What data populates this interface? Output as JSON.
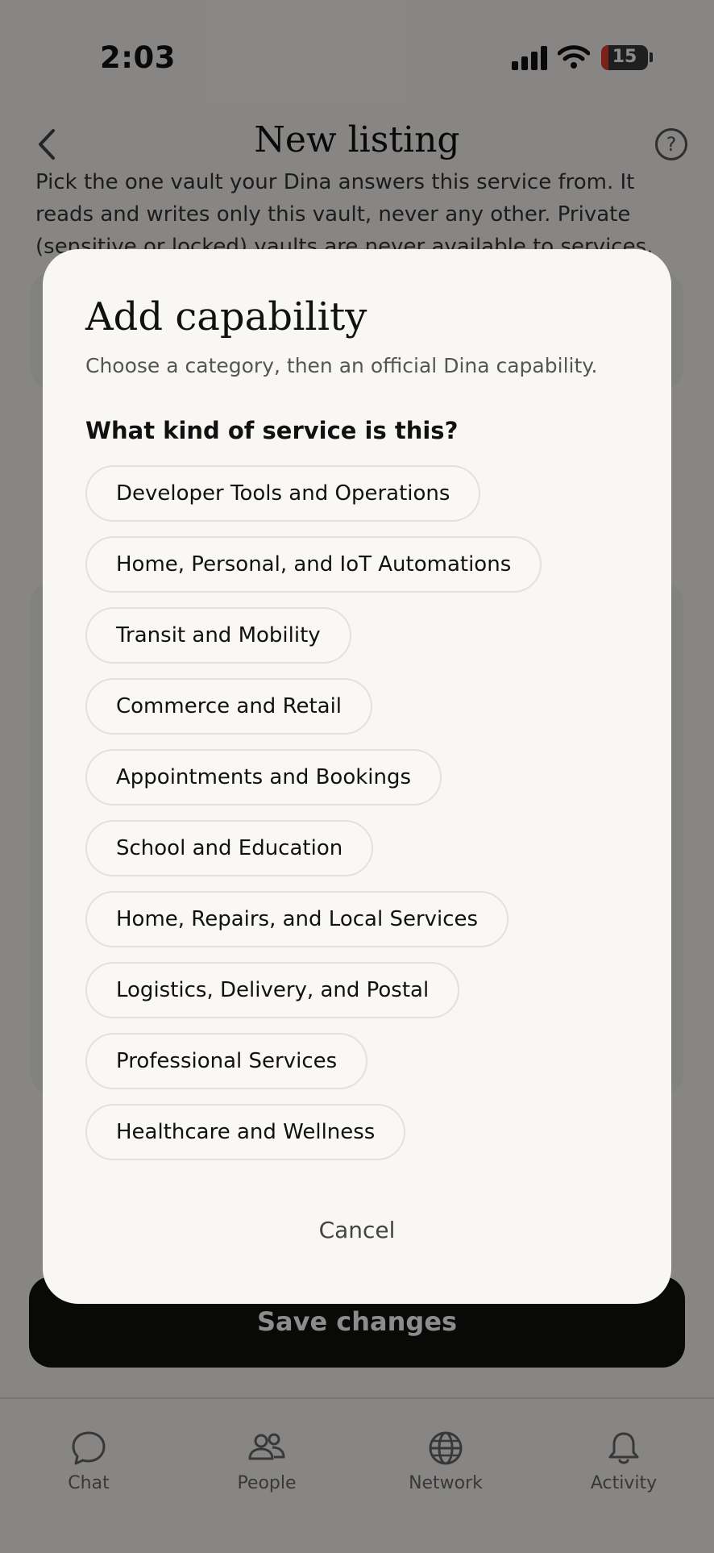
{
  "status": {
    "time": "2:03",
    "battery": "15"
  },
  "header": {
    "title": "New listing"
  },
  "background": {
    "intro_text": "Pick the one vault your Dina answers this service from. It reads and writes only this vault, never any other. Private (sensitive or locked) vaults are never available to services.",
    "save_button": "Save changes"
  },
  "tabs": [
    {
      "label": "Chat",
      "icon": "chat-bubble-icon"
    },
    {
      "label": "People",
      "icon": "people-icon"
    },
    {
      "label": "Network",
      "icon": "globe-icon"
    },
    {
      "label": "Activity",
      "icon": "bell-icon"
    }
  ],
  "modal": {
    "title": "Add capability",
    "subtitle": "Choose a category, then an official Dina capability.",
    "question": "What kind of service is this?",
    "categories": [
      "Developer Tools and Operations",
      "Home, Personal, and IoT Automations",
      "Transit and Mobility",
      "Commerce and Retail",
      "Appointments and Bookings",
      "School and Education",
      "Home, Repairs, and Local Services",
      "Logistics, Delivery, and Postal",
      "Professional Services",
      "Healthcare and Wellness"
    ],
    "cancel_label": "Cancel"
  },
  "colors": {
    "overlay": "#000000",
    "accent_dark": "#121110",
    "battery_low": "#e23b30"
  }
}
